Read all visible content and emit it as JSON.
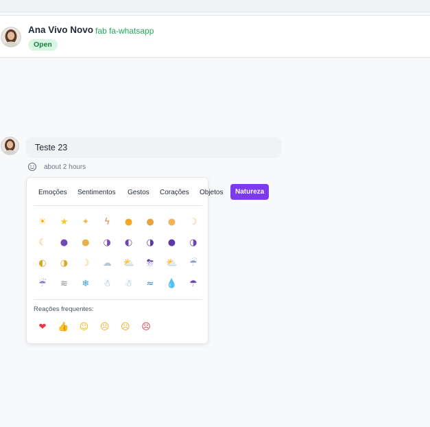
{
  "header": {
    "contact_name": "Ana Vivo Novo",
    "channel": "fab fa-whatsapp",
    "status": "Open"
  },
  "message": {
    "text": "Teste 23",
    "timestamp": "about 2 hours"
  },
  "picker": {
    "active_tab": "Natureza",
    "tabs": [
      {
        "label": "Emoções"
      },
      {
        "label": "Sentimentos"
      },
      {
        "label": "Gestos"
      },
      {
        "label": "Corações"
      },
      {
        "label": "Objetos"
      },
      {
        "label": "Natureza"
      }
    ],
    "emojis": [
      "☀",
      "★",
      "✦",
      "ϟ",
      "●",
      "●",
      "●",
      "☽",
      "☾",
      "●",
      "●",
      "◑",
      "◐",
      "◑",
      "●",
      "◑",
      "◐",
      "◑",
      "☽",
      "☁",
      "⛅",
      "⛈",
      "⛅",
      "☔",
      "☔",
      "≋",
      "❄",
      "☃",
      "☃",
      "≈",
      "💧",
      "☂"
    ],
    "frequent_label": "Reações frequentes:",
    "frequent": [
      "❤",
      "👍",
      "☺",
      "☹",
      "☹",
      "☹"
    ],
    "accent_color": "#7c3aed"
  },
  "colors": {
    "badge_bg": "#d9f6e4",
    "badge_text": "#15803d",
    "channel": "#22a559"
  }
}
